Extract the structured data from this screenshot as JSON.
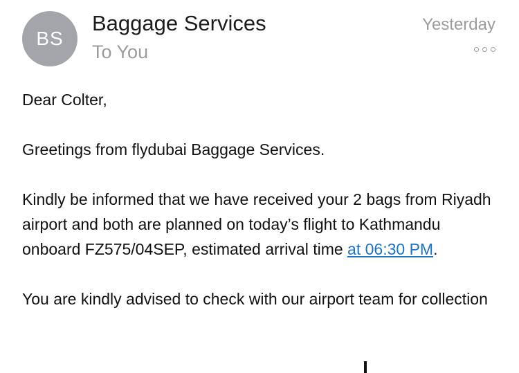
{
  "header": {
    "avatar_initials": "BS",
    "sender": "Baggage Services",
    "recipient": "To You",
    "date": "Yesterday"
  },
  "message": {
    "greeting": "Dear Colter,",
    "intro": "Greetings from flydubai Baggage Services.",
    "para1_text": "Kindly be informed that we have received your 2 bags from Riyadh airport and both are planned on today’s flight to Kathmandu onboard FZ575/04SEP, estimated arrival time ",
    "para1_link": "at 06:30 PM",
    "para1_end": ".",
    "para2": "You are kindly advised to check with our airport team for collection"
  },
  "colors": {
    "avatar": "#a3a5aa",
    "link": "#1a73c9",
    "secondary_text": "#9b9ba0"
  }
}
